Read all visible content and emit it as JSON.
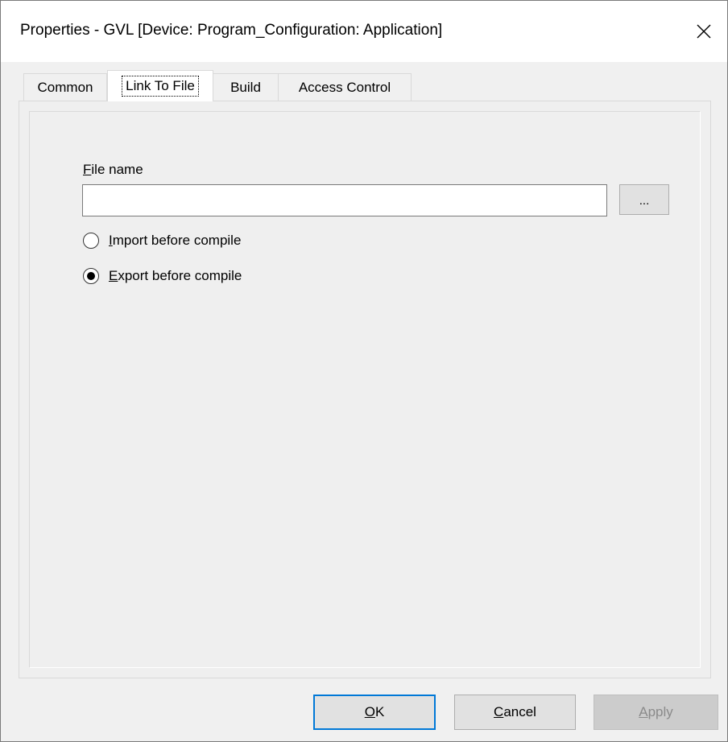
{
  "window": {
    "title": "Properties - GVL [Device: Program_Configuration: Application]"
  },
  "tabs": [
    {
      "label": "Common"
    },
    {
      "label": "Link To File",
      "active": true
    },
    {
      "label": "Build"
    },
    {
      "label": "Access Control"
    }
  ],
  "link_to_file": {
    "file_name_label_first": "F",
    "file_name_label_rest": "ile name",
    "file_name_value": "",
    "browse_label": "...",
    "import_label_first": "I",
    "import_label_rest": "mport before compile",
    "import_checked": false,
    "export_label_first": "E",
    "export_label_rest": "xport before compile",
    "export_checked": true
  },
  "buttons": {
    "ok_first": "O",
    "ok_rest": "K",
    "cancel_first": "C",
    "cancel_rest": "ancel",
    "apply_first": "A",
    "apply_rest": "pply"
  },
  "colors": {
    "default_button_border": "#0078d7",
    "disabled_text": "#8a8a8a"
  }
}
